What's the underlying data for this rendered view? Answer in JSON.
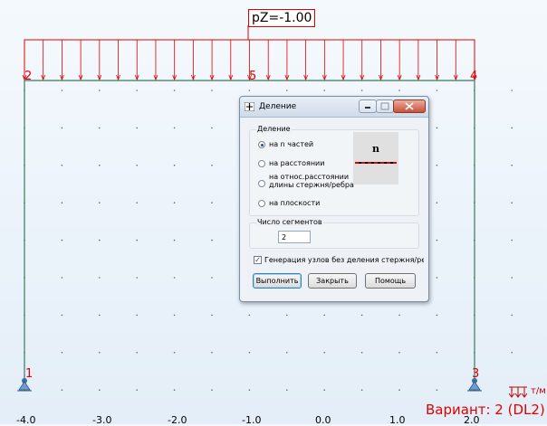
{
  "canvas": {
    "load_label": "pZ=-1.00",
    "nodes": [
      "1",
      "2",
      "3",
      "4",
      "5"
    ],
    "axis_labels": [
      "-4.0",
      "-3.0",
      "-2.0",
      "-1.0",
      "0.0",
      "1.0",
      "2.0"
    ],
    "variant": "Вариант: 2 (DL2)",
    "units": "т/м",
    "colors": {
      "frame": "#3a7a5a",
      "load": "#e00000",
      "support": "#3a6ea5"
    }
  },
  "dialog": {
    "title": "Деление",
    "division_group": "Деление",
    "options": [
      {
        "label": "на  n частей",
        "selected": true
      },
      {
        "label": "на расстоянии",
        "selected": false
      },
      {
        "label_line1": "на относ.расстоянии",
        "label_line2": "длины стержня/ребра",
        "selected": false
      },
      {
        "label": "на плоскости",
        "selected": false
      }
    ],
    "preview_symbol": "n",
    "segments_group": "Число сегментов",
    "segments_value": "2",
    "generate_checkbox_label": "Генерация узлов без деления стержня/ребр",
    "generate_checked": true,
    "buttons": {
      "execute": "Выполнить",
      "close": "Закрыть",
      "help": "Помощь"
    }
  }
}
